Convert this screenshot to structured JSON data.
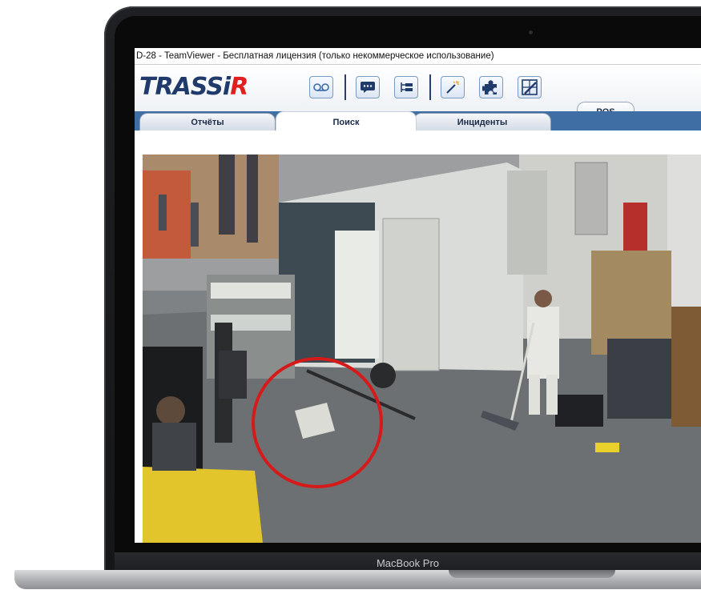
{
  "window": {
    "title": "D-28 - TeamViewer - Бесплатная лицензия (только некоммерческое использование)"
  },
  "app": {
    "logo_main": "TRASSi",
    "logo_accent": "R"
  },
  "toolbar": {
    "icons": [
      "voicemail-icon",
      "chat-icon",
      "hierarchy-icon",
      "magic-wand-icon",
      "puzzle-icon",
      "settings-grid-icon"
    ]
  },
  "tabs": {
    "pos_label": "POS",
    "reports_label": "Отчёты",
    "search_label": "Поиск",
    "incidents_label": "Инциденты",
    "active": "Поиск"
  },
  "device": {
    "label": "MacBook Pro"
  },
  "colors": {
    "highlight_circle": "#d61a1a",
    "tab_strip": "#3f6ea5",
    "logo_blue": "#1f3a6b",
    "logo_red": "#e02020"
  }
}
